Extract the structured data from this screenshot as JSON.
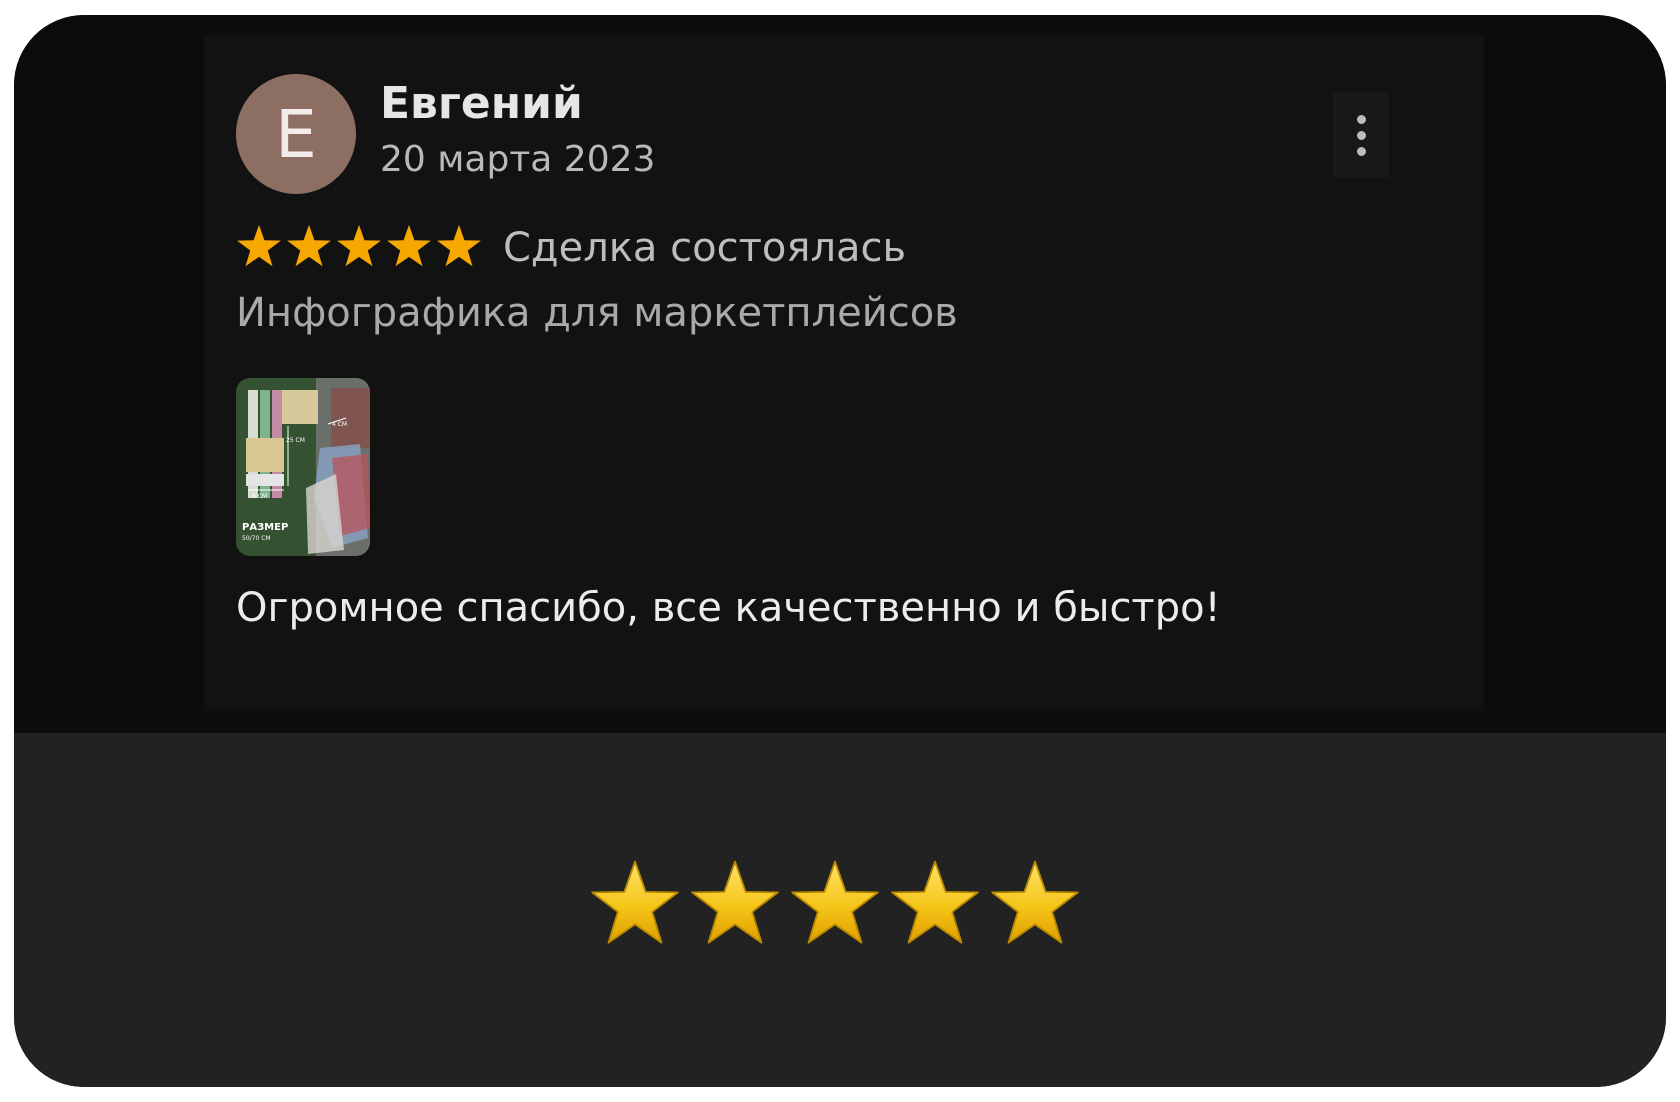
{
  "review": {
    "avatar_letter": "Е",
    "author": "Евгений",
    "date": "20 марта 2023",
    "rating": 5,
    "deal_status": "Сделка состоялась",
    "service": "Инфографика для маркетплейсов",
    "text": "Огромное спасибо, все качественно и быстро!",
    "thumbnail": {
      "size_label": "РАЗМЕР",
      "size_value": "50/70 СМ",
      "dim_25": "25 СМ",
      "dim_8": "8 СМ",
      "dim_4": "4 СМ"
    }
  },
  "summary": {
    "stars": 5
  },
  "colors": {
    "card_dark": "#0c0c0c",
    "panel": "#121212",
    "bottom": "#222222",
    "avatar": "#8d6e63",
    "star_orange": "#f6a700",
    "star_gold": "#f5c518"
  },
  "icons": [
    "star-icon",
    "more-vertical-icon",
    "gold-star-icon"
  ]
}
